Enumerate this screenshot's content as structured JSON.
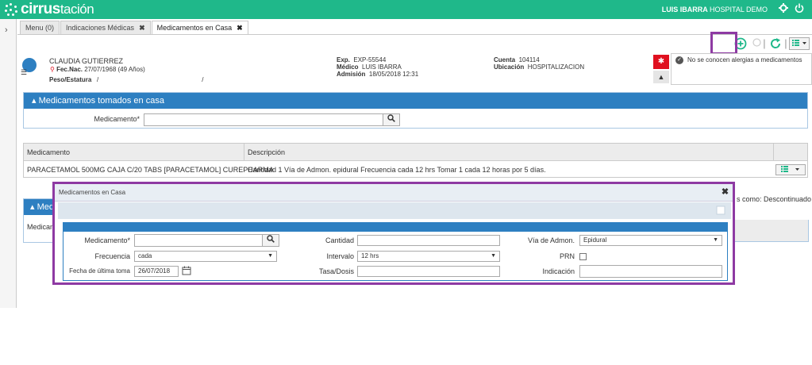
{
  "brand": {
    "name_bold": "cirrus",
    "name_light": "tación"
  },
  "header": {
    "user_name": "LUIS IBARRA",
    "hospital": "HOSPITAL DEMO",
    "settings_icon": "gear-icon",
    "power_icon": "power-icon"
  },
  "tabs": [
    {
      "label": "Menu (0)"
    },
    {
      "label": "Indicaciones Médicas"
    },
    {
      "label": "Medicamentos en Casa"
    }
  ],
  "patient": {
    "name": "CLAUDIA GUTIERREZ",
    "dob_label": "Fec.Nac.",
    "dob_value": "27/07/1968 (49 Años)",
    "weight_label": "Peso/Estatura",
    "weight_value": "/",
    "weight_value2": "/",
    "exp_label": "Exp.",
    "exp_value": "EXP-55544",
    "medico_label": "Médico",
    "medico_value": "LUIS IBARRA",
    "admision_label": "Admisión",
    "admision_value": "18/05/2018 12:31",
    "cuenta_label": "Cuenta",
    "cuenta_value": "104114",
    "ubicacion_label": "Ubicación",
    "ubicacion_value": "HOSPITALIZACION",
    "allergy_text": "No se conocen alergias a medicamentos"
  },
  "panel_top": {
    "title": "Medicamentos tomados en casa",
    "medicamento_label": "Medicamento*"
  },
  "table": {
    "col_medicamento": "Medicamento",
    "col_descripcion": "Descripción",
    "row_medicamento": "PARACETAMOL 500MG CAJA C/20 TABS [PARACETAMOL] CUREPHARMA",
    "row_descripcion": "Cantidad 1 Vía de Admon. epidural Frecuencia cada 12 hrs Tomar 1 cada 12 horas por 5 días."
  },
  "background": {
    "status_text": "s como: Descontinuado",
    "panel2_title_partial": "Med",
    "panel2_col_partial": "Medicam"
  },
  "modal": {
    "title": "Medicamentos en Casa",
    "medicamento_label": "Medicamento*",
    "medicamento_value": "",
    "cantidad_label": "Cantidad",
    "cantidad_value": "",
    "via_label": "Vía de Admon.",
    "via_value": "Epidural",
    "frecuencia_label": "Frecuencia",
    "frecuencia_value": "cada",
    "intervalo_label": "Intervalo",
    "intervalo_value": "12 hrs",
    "prn_label": "PRN",
    "fecha_label": "Fecha de última toma",
    "fecha_value": "26/07/2018",
    "tasa_label": "Tasa/Dosis",
    "tasa_value": "",
    "indicacion_label": "Indicación",
    "indicacion_value": ""
  },
  "colors": {
    "brand_green": "#1fb88a",
    "panel_blue": "#2d7fc1",
    "highlight_purple": "#8e3aa3",
    "alert_red": "#e0101f"
  }
}
